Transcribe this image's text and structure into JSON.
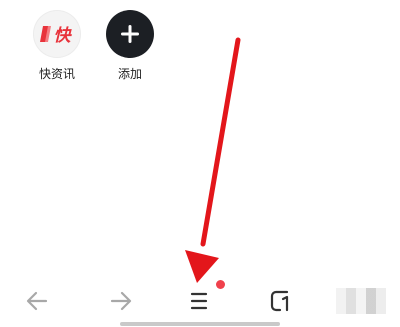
{
  "shortcuts": [
    {
      "label": "快资讯",
      "icon": "kuaizixun-logo-icon",
      "logo_text": "快",
      "logo_color": "#e8333b"
    },
    {
      "label": "添加",
      "icon": "plus-icon"
    }
  ],
  "bottom_nav": {
    "items": [
      {
        "icon": "back-arrow-icon"
      },
      {
        "icon": "forward-arrow-icon"
      },
      {
        "icon": "menu-icon",
        "notification": true
      },
      {
        "icon": "tabs-icon"
      },
      {
        "icon": "profile-avatar"
      }
    ]
  },
  "annotation": {
    "arrow_color": "#e3161b",
    "points_to": "menu-icon"
  },
  "colors": {
    "icon_gray": "#9a9a9a",
    "icon_dark": "#333333",
    "notification_dot": "#f0414c",
    "add_button_bg": "#1c1f24"
  }
}
